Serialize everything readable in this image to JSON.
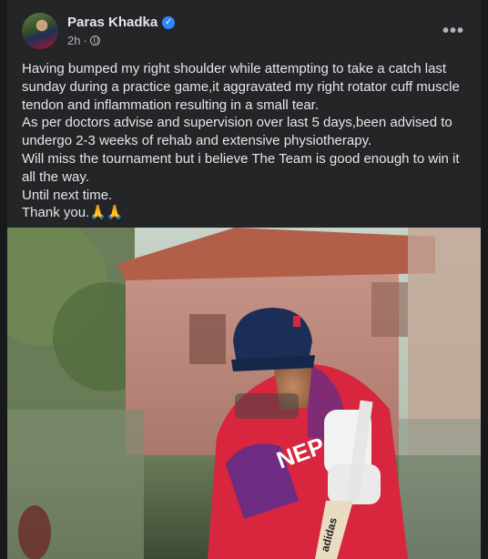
{
  "post": {
    "author": "Paras Khadka",
    "verified": true,
    "time": "2h",
    "time_separator": "·",
    "more_label": "•••",
    "text": "Having bumped my right shoulder while attempting to take a catch last sunday during a practice game,it aggravated my right rotator cuff muscle tendon and inflammation resulting in a small tear.\nAs per doctors advise and supervision over last 5 days,been advised to undergo 2-3 weeks of rehab and extensive physiotherapy.\nWill miss the tournament but i believe The Team is good enough to win it all the way.\nUntil next time.\nThank you.🙏🙏"
  },
  "photo": {
    "jersey_text": "NEPAL",
    "bat_brand": "adidas"
  },
  "colors": {
    "background": "#18191a",
    "card": "#242526",
    "text_primary": "#e4e6eb",
    "text_secondary": "#b0b3b8",
    "verified_blue": "#2d88ff",
    "jersey_red": "#d7263d",
    "jersey_purple": "#5b2d8e"
  },
  "icons": {
    "verified": "verified-badge-icon",
    "audience": "globe-icon",
    "more": "more-options-icon"
  }
}
